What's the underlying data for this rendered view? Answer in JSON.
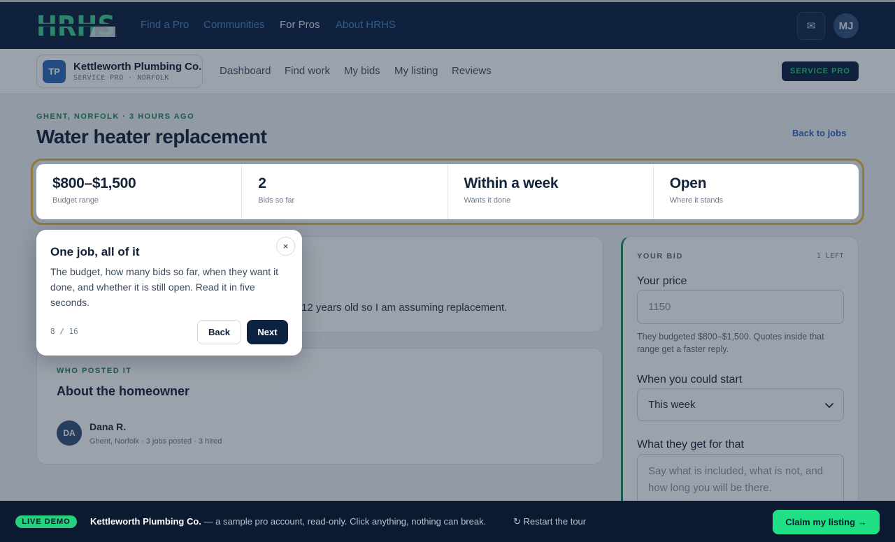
{
  "topnav": {
    "brand": "HRHS",
    "links": [
      "Find a Pro",
      "Communities",
      "For Pros",
      "About HRHS"
    ],
    "active": "For Pros",
    "mail_icon": "envelope-icon",
    "user_initials": "MJ"
  },
  "subnav": {
    "company_initials": "TP",
    "company_name": "Kettleworth Plumbing Co.",
    "company_sub": "SERVICE PRO · NORFOLK",
    "links": [
      "Dashboard",
      "Find work",
      "My bids",
      "My listing",
      "Reviews"
    ],
    "role_badge": "SERVICE PRO"
  },
  "job": {
    "eyebrow": "GHENT, NORFOLK · 3 HOURS AGO",
    "title": "Water heater replacement",
    "back_link": "Back to jobs",
    "stats": [
      {
        "value": "$800–$1,500",
        "label": "Budget range"
      },
      {
        "value": "2",
        "label": "Bids so far"
      },
      {
        "value": "Within a week",
        "label": "Wants it done"
      },
      {
        "value": "Open",
        "label": "Where it stands"
      }
    ],
    "description_visible": "12 years old so I am assuming replacement."
  },
  "homeowner": {
    "eyebrow": "WHO POSTED IT",
    "title": "About the homeowner",
    "initials": "DA",
    "name": "Dana R.",
    "meta": "Ghent, Norfolk · 3 jobs posted · 3 hired"
  },
  "bid": {
    "eyebrow": "YOUR BID",
    "remaining": "1 LEFT",
    "price_label": "Your price",
    "price_placeholder": "1150",
    "price_hint": "They budgeted $800–$1,500. Quotes inside that range get a faster reply.",
    "start_label": "When you could start",
    "start_value": "This week",
    "includes_label": "What they get for that",
    "includes_placeholder": "Say what is included, what is not, and how long you will be there."
  },
  "tour": {
    "title": "One job, all of it",
    "body": "The budget, how many bids so far, when they want it done, and whether it is still open. Read it in five seconds.",
    "step": "8 / 16",
    "back_label": "Back",
    "next_label": "Next",
    "close_label": "×"
  },
  "demo_bar": {
    "badge": "LIVE DEMO",
    "company": "Kettleworth Plumbing Co.",
    "message": " — a sample pro account, read-only. Click anything, nothing can break.",
    "restart": "↻ Restart the tour",
    "cta": "Claim my listing →"
  },
  "colors": {
    "navy": "#0d2141",
    "accent_green": "#26d07c",
    "link_blue": "#2f6cb8",
    "highlight": "#e5b93b"
  }
}
